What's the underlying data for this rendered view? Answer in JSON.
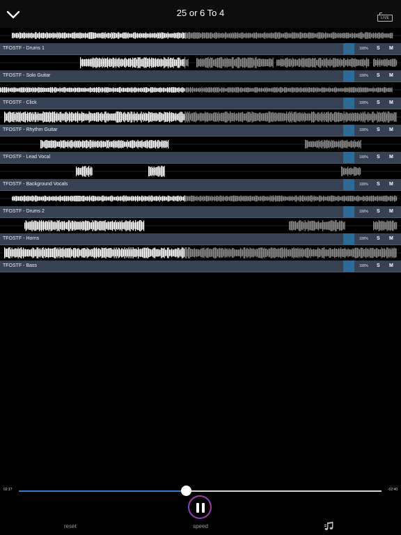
{
  "header": {
    "title": "25 or 6 To 4",
    "live_label": "LIVE"
  },
  "tracks": [
    {
      "name": "TFOSTF - Drums 1",
      "volume": "100%",
      "solo": "S",
      "mute": "M"
    },
    {
      "name": "TFOSTF - Solo Guitar",
      "volume": "100%",
      "solo": "S",
      "mute": "M"
    },
    {
      "name": "TFOSTF - Click",
      "volume": "100%",
      "solo": "S",
      "mute": "M"
    },
    {
      "name": "TFOSTF - Rhythm Guitar",
      "volume": "100%",
      "solo": "S",
      "mute": "M"
    },
    {
      "name": "TFOSTF - Lead Vocal",
      "volume": "100%",
      "solo": "S",
      "mute": "M"
    },
    {
      "name": "TFOSTF - Background Vocals",
      "volume": "100%",
      "solo": "S",
      "mute": "M"
    },
    {
      "name": "TFOSTF - Drums 2",
      "volume": "100%",
      "solo": "S",
      "mute": "M"
    },
    {
      "name": "TFOSTF - Horns",
      "volume": "100%",
      "solo": "S",
      "mute": "M"
    },
    {
      "name": "TFOSTF - Bass",
      "volume": "100%",
      "solo": "S",
      "mute": "M"
    }
  ],
  "playback": {
    "elapsed": "02:17",
    "remaining": "-02:40",
    "progress": 0.46,
    "state": "playing"
  },
  "controls": {
    "reset_label": "reset",
    "speed_label": "speed"
  },
  "colors": {
    "track_bar": "#364254",
    "volume_fill": "#2d6a96",
    "progress_fill": "#2f7fd2",
    "played_wave": "#ffffff",
    "unplayed_wave": "#8a8a8a"
  },
  "icons": {
    "back": "chevron-down-icon",
    "live": "live-icon",
    "play_pause": "pause-icon",
    "notes": "music-notes-icon"
  }
}
